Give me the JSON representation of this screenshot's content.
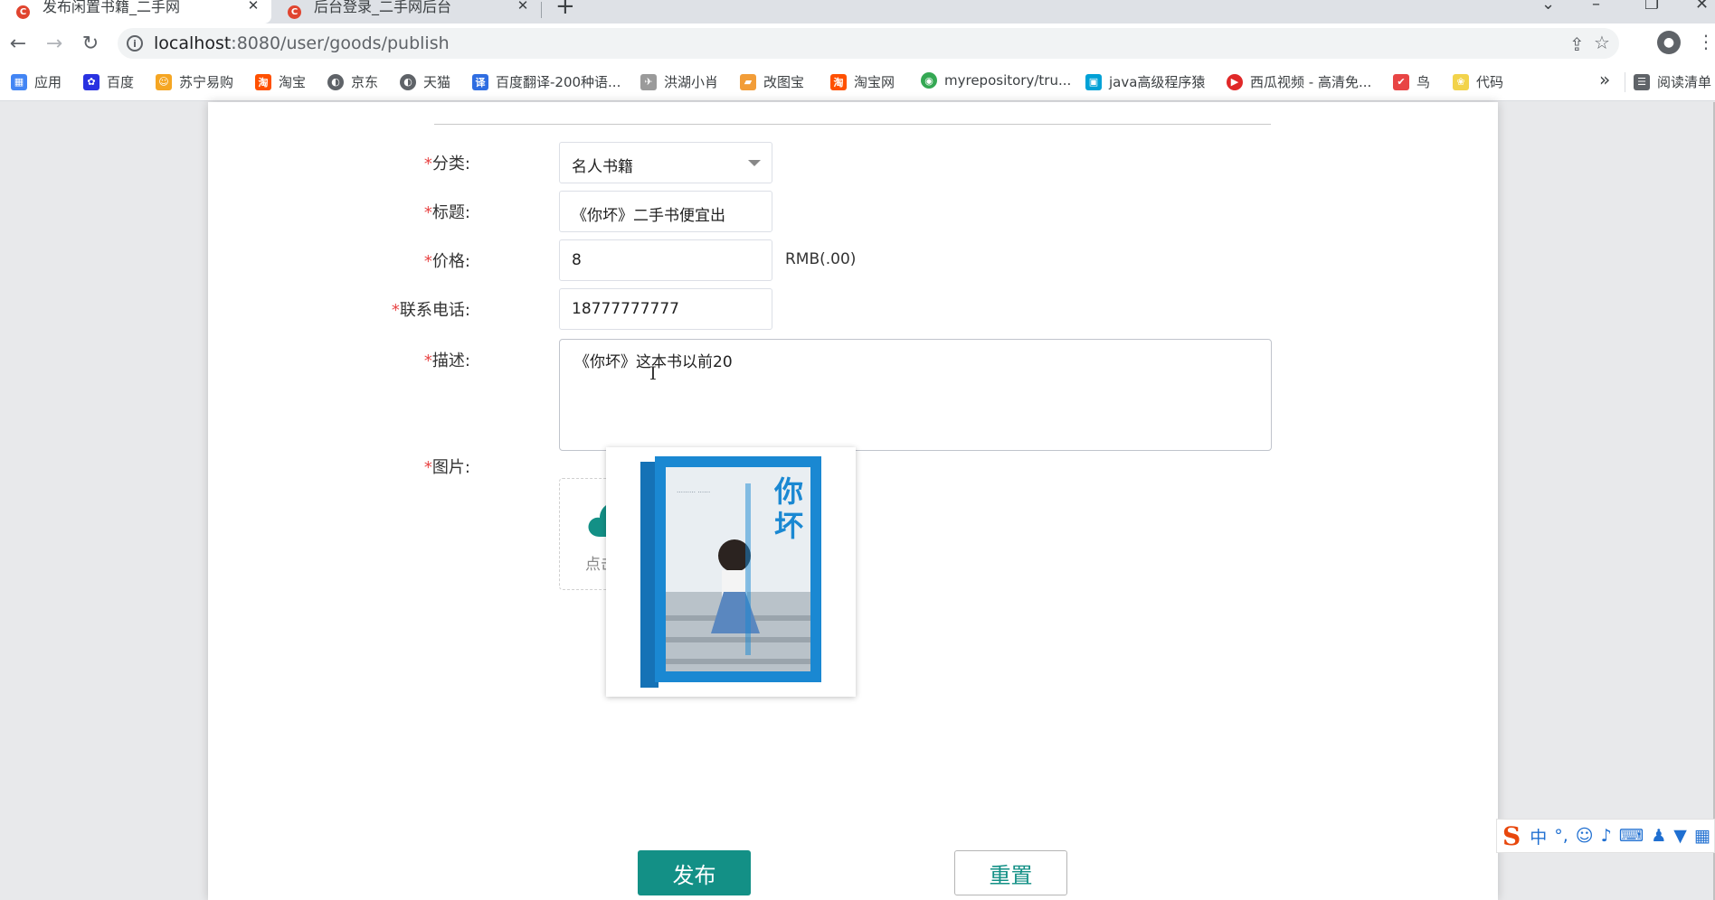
{
  "browser": {
    "tabs": [
      {
        "title": "发布闲置书籍_二手网",
        "favicon": "C",
        "active": true
      },
      {
        "title": "后台登录_二手网后台",
        "favicon": "C",
        "active": false
      }
    ],
    "url_host": "localhost",
    "url_path": ":8080/user/goods/publish",
    "bookmarks": [
      {
        "label": "应用",
        "icon": "apps-grid-icon",
        "color": "#4285f4"
      },
      {
        "label": "百度",
        "icon": "baidu-paw-icon",
        "color": "#2932e1"
      },
      {
        "label": "苏宁易购",
        "icon": "suning-icon",
        "color": "#f5a623"
      },
      {
        "label": "淘宝",
        "icon": "taobao-icon",
        "color": "#ff5000"
      },
      {
        "label": "京东",
        "icon": "globe-icon",
        "color": "#5f6368"
      },
      {
        "label": "天猫",
        "icon": "globe-icon",
        "color": "#5f6368"
      },
      {
        "label": "百度翻译-200种语...",
        "icon": "translate-icon",
        "color": "#2f6de1"
      },
      {
        "label": "洪湖小肖",
        "icon": "bird-icon",
        "color": "#7a7a7a"
      },
      {
        "label": "改图宝",
        "icon": "folder-icon",
        "color": "#f29d38"
      },
      {
        "label": "淘宝网",
        "icon": "taobao-icon",
        "color": "#ff5000"
      },
      {
        "label": "myrepository/tru...",
        "icon": "chrome-icon",
        "color": "#34a853"
      },
      {
        "label": "java高级程序猿",
        "icon": "bilibili-tv-icon",
        "color": "#00a1d6"
      },
      {
        "label": "西瓜视频 - 高清免...",
        "icon": "xigua-icon",
        "color": "#e02828"
      },
      {
        "label": "鸟",
        "icon": "bird-icon",
        "color": "#e84545"
      },
      {
        "label": "代码",
        "icon": "leaf-icon",
        "color": "#f2d34b"
      }
    ],
    "bookmarks_more": "»",
    "reading_list": "阅读清单"
  },
  "form": {
    "required_mark": "*",
    "category_label": "分类:",
    "category_value": "名人书籍",
    "title_label": "标题:",
    "title_value": "《你坏》二手书便宜出",
    "price_label": "价格:",
    "price_value": "8",
    "price_unit": "RMB(.00)",
    "phone_label": "联系电话:",
    "phone_value": "18777777777",
    "desc_label": "描述:",
    "desc_value": "《你坏》这本书以前20",
    "image_label": "图片:",
    "upload_text": "点击上传",
    "book_title": "你坏",
    "publish_button": "发布",
    "reset_button": "重置"
  },
  "ime": {
    "logo": "S",
    "mode": "中",
    "punct": "°,"
  },
  "colors": {
    "primary": "#139086",
    "required": "#e84545",
    "book_blue": "#1a88d2"
  }
}
